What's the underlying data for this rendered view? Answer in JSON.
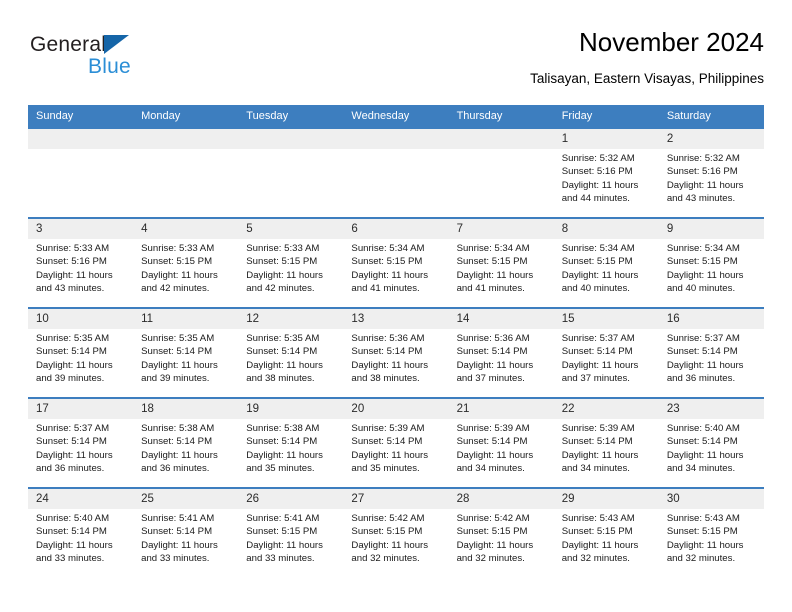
{
  "brand": {
    "name_top": "General",
    "name_bottom": "Blue",
    "triangle_color": "#1565a8",
    "blue_text_color": "#2b8ed6"
  },
  "header": {
    "title": "November 2024",
    "subtitle": "Talisayan, Eastern Visayas, Philippines"
  },
  "theme": {
    "header_blue": "#3d7ebf",
    "daynum_band": "#efefef",
    "row_border": "#3d7ebf"
  },
  "weekdays": [
    "Sunday",
    "Monday",
    "Tuesday",
    "Wednesday",
    "Thursday",
    "Friday",
    "Saturday"
  ],
  "labels": {
    "sunrise": "Sunrise:",
    "sunset": "Sunset:",
    "daylight": "Daylight:"
  },
  "weeks": [
    [
      {
        "day": "",
        "sunrise": "",
        "sunset": "",
        "daylight1": "",
        "daylight2": "",
        "empty": true
      },
      {
        "day": "",
        "sunrise": "",
        "sunset": "",
        "daylight1": "",
        "daylight2": "",
        "empty": true
      },
      {
        "day": "",
        "sunrise": "",
        "sunset": "",
        "daylight1": "",
        "daylight2": "",
        "empty": true
      },
      {
        "day": "",
        "sunrise": "",
        "sunset": "",
        "daylight1": "",
        "daylight2": "",
        "empty": true
      },
      {
        "day": "",
        "sunrise": "",
        "sunset": "",
        "daylight1": "",
        "daylight2": "",
        "empty": true
      },
      {
        "day": "1",
        "sunrise": "Sunrise: 5:32 AM",
        "sunset": "Sunset: 5:16 PM",
        "daylight1": "Daylight: 11 hours",
        "daylight2": "and 44 minutes."
      },
      {
        "day": "2",
        "sunrise": "Sunrise: 5:32 AM",
        "sunset": "Sunset: 5:16 PM",
        "daylight1": "Daylight: 11 hours",
        "daylight2": "and 43 minutes."
      }
    ],
    [
      {
        "day": "3",
        "sunrise": "Sunrise: 5:33 AM",
        "sunset": "Sunset: 5:16 PM",
        "daylight1": "Daylight: 11 hours",
        "daylight2": "and 43 minutes."
      },
      {
        "day": "4",
        "sunrise": "Sunrise: 5:33 AM",
        "sunset": "Sunset: 5:15 PM",
        "daylight1": "Daylight: 11 hours",
        "daylight2": "and 42 minutes."
      },
      {
        "day": "5",
        "sunrise": "Sunrise: 5:33 AM",
        "sunset": "Sunset: 5:15 PM",
        "daylight1": "Daylight: 11 hours",
        "daylight2": "and 42 minutes."
      },
      {
        "day": "6",
        "sunrise": "Sunrise: 5:34 AM",
        "sunset": "Sunset: 5:15 PM",
        "daylight1": "Daylight: 11 hours",
        "daylight2": "and 41 minutes."
      },
      {
        "day": "7",
        "sunrise": "Sunrise: 5:34 AM",
        "sunset": "Sunset: 5:15 PM",
        "daylight1": "Daylight: 11 hours",
        "daylight2": "and 41 minutes."
      },
      {
        "day": "8",
        "sunrise": "Sunrise: 5:34 AM",
        "sunset": "Sunset: 5:15 PM",
        "daylight1": "Daylight: 11 hours",
        "daylight2": "and 40 minutes."
      },
      {
        "day": "9",
        "sunrise": "Sunrise: 5:34 AM",
        "sunset": "Sunset: 5:15 PM",
        "daylight1": "Daylight: 11 hours",
        "daylight2": "and 40 minutes."
      }
    ],
    [
      {
        "day": "10",
        "sunrise": "Sunrise: 5:35 AM",
        "sunset": "Sunset: 5:14 PM",
        "daylight1": "Daylight: 11 hours",
        "daylight2": "and 39 minutes."
      },
      {
        "day": "11",
        "sunrise": "Sunrise: 5:35 AM",
        "sunset": "Sunset: 5:14 PM",
        "daylight1": "Daylight: 11 hours",
        "daylight2": "and 39 minutes."
      },
      {
        "day": "12",
        "sunrise": "Sunrise: 5:35 AM",
        "sunset": "Sunset: 5:14 PM",
        "daylight1": "Daylight: 11 hours",
        "daylight2": "and 38 minutes."
      },
      {
        "day": "13",
        "sunrise": "Sunrise: 5:36 AM",
        "sunset": "Sunset: 5:14 PM",
        "daylight1": "Daylight: 11 hours",
        "daylight2": "and 38 minutes."
      },
      {
        "day": "14",
        "sunrise": "Sunrise: 5:36 AM",
        "sunset": "Sunset: 5:14 PM",
        "daylight1": "Daylight: 11 hours",
        "daylight2": "and 37 minutes."
      },
      {
        "day": "15",
        "sunrise": "Sunrise: 5:37 AM",
        "sunset": "Sunset: 5:14 PM",
        "daylight1": "Daylight: 11 hours",
        "daylight2": "and 37 minutes."
      },
      {
        "day": "16",
        "sunrise": "Sunrise: 5:37 AM",
        "sunset": "Sunset: 5:14 PM",
        "daylight1": "Daylight: 11 hours",
        "daylight2": "and 36 minutes."
      }
    ],
    [
      {
        "day": "17",
        "sunrise": "Sunrise: 5:37 AM",
        "sunset": "Sunset: 5:14 PM",
        "daylight1": "Daylight: 11 hours",
        "daylight2": "and 36 minutes."
      },
      {
        "day": "18",
        "sunrise": "Sunrise: 5:38 AM",
        "sunset": "Sunset: 5:14 PM",
        "daylight1": "Daylight: 11 hours",
        "daylight2": "and 36 minutes."
      },
      {
        "day": "19",
        "sunrise": "Sunrise: 5:38 AM",
        "sunset": "Sunset: 5:14 PM",
        "daylight1": "Daylight: 11 hours",
        "daylight2": "and 35 minutes."
      },
      {
        "day": "20",
        "sunrise": "Sunrise: 5:39 AM",
        "sunset": "Sunset: 5:14 PM",
        "daylight1": "Daylight: 11 hours",
        "daylight2": "and 35 minutes."
      },
      {
        "day": "21",
        "sunrise": "Sunrise: 5:39 AM",
        "sunset": "Sunset: 5:14 PM",
        "daylight1": "Daylight: 11 hours",
        "daylight2": "and 34 minutes."
      },
      {
        "day": "22",
        "sunrise": "Sunrise: 5:39 AM",
        "sunset": "Sunset: 5:14 PM",
        "daylight1": "Daylight: 11 hours",
        "daylight2": "and 34 minutes."
      },
      {
        "day": "23",
        "sunrise": "Sunrise: 5:40 AM",
        "sunset": "Sunset: 5:14 PM",
        "daylight1": "Daylight: 11 hours",
        "daylight2": "and 34 minutes."
      }
    ],
    [
      {
        "day": "24",
        "sunrise": "Sunrise: 5:40 AM",
        "sunset": "Sunset: 5:14 PM",
        "daylight1": "Daylight: 11 hours",
        "daylight2": "and 33 minutes."
      },
      {
        "day": "25",
        "sunrise": "Sunrise: 5:41 AM",
        "sunset": "Sunset: 5:14 PM",
        "daylight1": "Daylight: 11 hours",
        "daylight2": "and 33 minutes."
      },
      {
        "day": "26",
        "sunrise": "Sunrise: 5:41 AM",
        "sunset": "Sunset: 5:15 PM",
        "daylight1": "Daylight: 11 hours",
        "daylight2": "and 33 minutes."
      },
      {
        "day": "27",
        "sunrise": "Sunrise: 5:42 AM",
        "sunset": "Sunset: 5:15 PM",
        "daylight1": "Daylight: 11 hours",
        "daylight2": "and 32 minutes."
      },
      {
        "day": "28",
        "sunrise": "Sunrise: 5:42 AM",
        "sunset": "Sunset: 5:15 PM",
        "daylight1": "Daylight: 11 hours",
        "daylight2": "and 32 minutes."
      },
      {
        "day": "29",
        "sunrise": "Sunrise: 5:43 AM",
        "sunset": "Sunset: 5:15 PM",
        "daylight1": "Daylight: 11 hours",
        "daylight2": "and 32 minutes."
      },
      {
        "day": "30",
        "sunrise": "Sunrise: 5:43 AM",
        "sunset": "Sunset: 5:15 PM",
        "daylight1": "Daylight: 11 hours",
        "daylight2": "and 32 minutes."
      }
    ]
  ]
}
